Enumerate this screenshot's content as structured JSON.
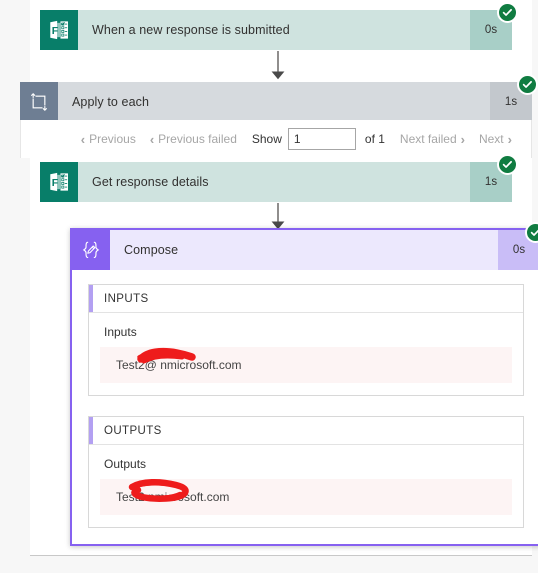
{
  "flow": {
    "steps": [
      {
        "id": "trigger",
        "name": "When a new response is submitted",
        "duration": "0s",
        "status": "succeeded",
        "icon": "microsoft-forms-icon",
        "connector": "arrow-down"
      },
      {
        "id": "apply-to-each",
        "name": "Apply to each",
        "duration": "1s",
        "status": "succeeded",
        "icon": "apply-to-each-loop-icon",
        "connector": "none"
      },
      {
        "id": "get-response-details",
        "name": "Get response details",
        "duration": "1s",
        "status": "succeeded",
        "icon": "microsoft-forms-icon",
        "connector": "arrow-down"
      },
      {
        "id": "compose",
        "name": "Compose",
        "duration": "0s",
        "status": "succeeded",
        "icon": "compose-braces-icon",
        "connector": "none"
      }
    ]
  },
  "pager": {
    "previous_label": "Previous",
    "previous_failed_label": "Previous failed",
    "show_label": "Show",
    "page_value": "1",
    "page_placeholder": "1",
    "of_label": "of 1",
    "next_failed_label": "Next failed",
    "next_label": "Next",
    "chevron_left": "‹",
    "chevron_right": "›"
  },
  "compose": {
    "inputs_panel": {
      "header": "INPUTS",
      "field_label": "Inputs",
      "value": "Test2@                     nmicrosoft.com",
      "redacted": true
    },
    "outputs_panel": {
      "header": "OUTPUTS",
      "field_label": "Outputs",
      "value": "Test2                        nmicrosoft.com",
      "redacted": true
    }
  },
  "colors": {
    "forms_teal": "#087e69",
    "forms_teal_light": "#cfe3df",
    "loop_grey": "#6e7e93",
    "loop_grey_light": "#d6dade",
    "compose_purple": "#8661f0",
    "compose_purple_light": "#ece8fd",
    "status_green": "#107c41",
    "redaction_red": "#ee1c1c",
    "value_background": "#fdf4f4",
    "page_background": "#f7f7f7"
  }
}
